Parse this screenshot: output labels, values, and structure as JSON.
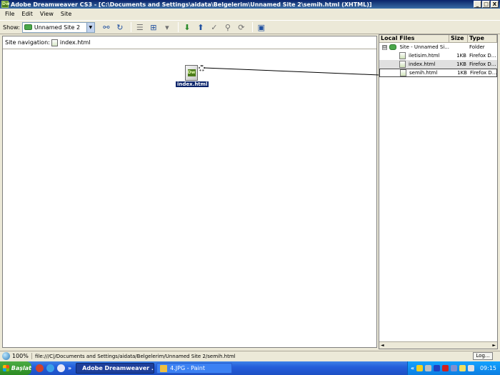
{
  "window": {
    "app_icon": "Dw",
    "title": "Adobe Dreamweaver CS3 - [C:\\Documents and Settings\\aidata\\Belgelerim\\Unnamed Site 2\\semih.html (XHTML)]",
    "controls": {
      "minimize": "_",
      "maximize": "□",
      "close": "X"
    }
  },
  "menu": [
    "File",
    "Edit",
    "View",
    "Site"
  ],
  "toolbar": {
    "show_label": "Show:",
    "site_value": "Unnamed Site 2",
    "dropdown_arrow": "▼",
    "buttons": [
      "connect-icon",
      "refresh-icon",
      "list-view-icon",
      "map-view-icon",
      "map-options-icon",
      "get-icon",
      "put-icon",
      "check-out-icon",
      "check-in-icon",
      "synchronize-icon",
      "expand-icon"
    ]
  },
  "site_map": {
    "nav_label": "Site navigation:",
    "nav_file": "index.html",
    "home_node_label": "index.html",
    "home_node_icon": "Dw"
  },
  "files_panel": {
    "headers": {
      "name": "Local Files",
      "size": "Size",
      "type": "Type"
    },
    "root": {
      "expander": "⊟",
      "name": "Site - Unnamed Si...",
      "size": "",
      "type": "Folder"
    },
    "files": [
      {
        "name": "iletisim.html",
        "size": "1KB",
        "type": "Firefox D..."
      },
      {
        "name": "index.html",
        "size": "1KB",
        "type": "Firefox D..."
      },
      {
        "name": "semih.html",
        "size": "1KB",
        "type": "Firefox D..."
      }
    ],
    "scroll_left": "◄",
    "scroll_right": "►"
  },
  "status": {
    "zoom": "100%",
    "path": "file:///C|/Documents and Settings/aidata/Belgelerim/Unnamed Site 2/semih.html",
    "log_button": "Log..."
  },
  "taskbar": {
    "start": "Başlat",
    "quicklaunch_more": "»",
    "tasks": [
      {
        "label": "Adobe Dreamweaver ...",
        "active": true
      },
      {
        "label": "4.JPG - Paint",
        "active": false
      }
    ],
    "tray_chevron": "«",
    "clock": "09:15"
  },
  "colors": {
    "titlebar": "#0a246a",
    "selection": "#0a246a",
    "dreamweaver_green": "#4c7c1c",
    "taskbar": "#245edb",
    "start": "#2b8a22"
  }
}
